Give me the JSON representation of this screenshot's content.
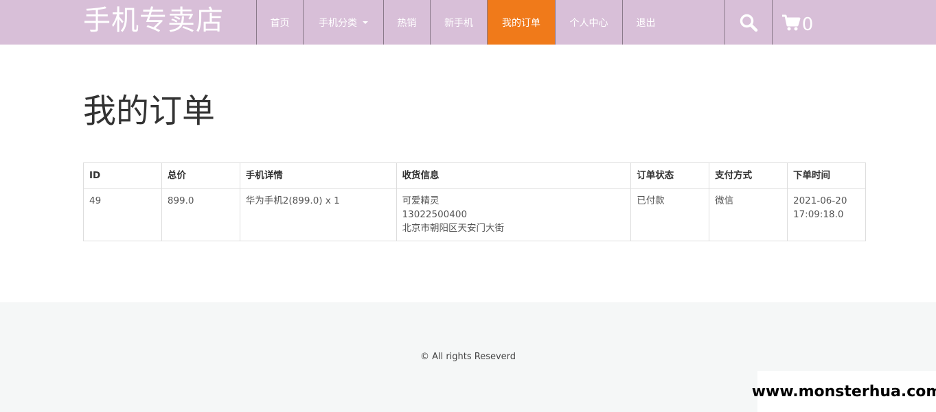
{
  "header": {
    "brand": "手机专卖店",
    "nav": [
      {
        "label": "首页",
        "width": 68
      },
      {
        "label": "手机分类",
        "width": 117,
        "dropdown": true
      },
      {
        "label": "热销",
        "width": 68
      },
      {
        "label": "新手机",
        "width": 83
      },
      {
        "label": "我的订单",
        "width": 99,
        "active": true
      },
      {
        "label": "个人中心",
        "width": 98
      },
      {
        "label": "退出",
        "width": 0
      }
    ],
    "search_icon": "search-icon",
    "cart_icon": "cart-icon",
    "cart_count": "0",
    "colors": {
      "header_bg": "#d8bfd8",
      "active_bg": "#f07a1a"
    }
  },
  "page": {
    "title": "我的订单"
  },
  "orders": {
    "headers": [
      "ID",
      "总价",
      "手机详情",
      "收货信息",
      "订单状态",
      "支付方式",
      "下单时间"
    ],
    "rows": [
      {
        "id": "49",
        "total": "899.0",
        "details": "华为手机2(899.0) x 1",
        "receiver_name": "可爱精灵",
        "receiver_phone": "13022500400",
        "receiver_address": "北京市朝阳区天安门大街",
        "status": "已付款",
        "payment": "微信",
        "time_date": "2021-06-20",
        "time_clock": "17:09:18.0"
      }
    ]
  },
  "footer": {
    "copyright": "© All rights Reseverd"
  },
  "watermark": "www.monsterhua.com"
}
